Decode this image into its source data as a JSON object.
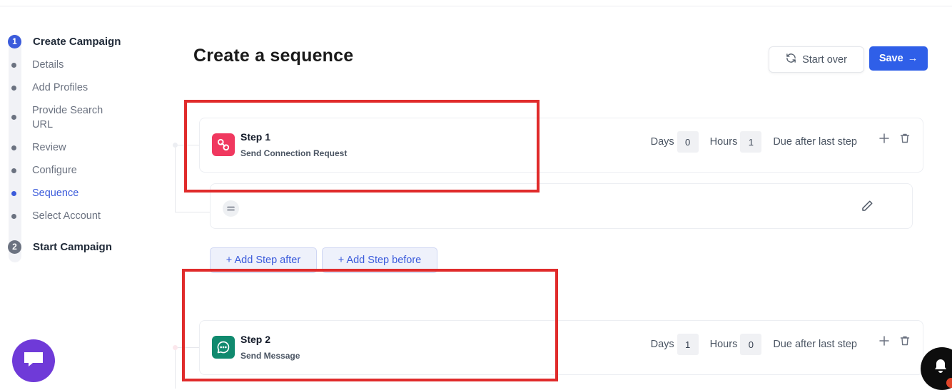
{
  "sidebar": {
    "step1": {
      "number": "1",
      "label": "Create Campaign"
    },
    "items": [
      {
        "label": "Details",
        "active": false
      },
      {
        "label": "Add Profiles",
        "active": false
      },
      {
        "label": "Provide Search URL",
        "active": false
      },
      {
        "label": "Review",
        "active": false
      },
      {
        "label": "Configure",
        "active": false
      },
      {
        "label": "Sequence",
        "active": true
      },
      {
        "label": "Select Account",
        "active": false
      }
    ],
    "step2": {
      "number": "2",
      "label": "Start Campaign"
    }
  },
  "header": {
    "title": "Create a sequence",
    "start_over_label": "Start over",
    "save_label": "Save",
    "save_arrow": "→"
  },
  "steps": [
    {
      "title": "Step 1",
      "subtitle": "Send Connection Request",
      "icon": "link-icon",
      "icon_color": "#f0385f",
      "days_label": "Days",
      "days": "0",
      "hours_label": "Hours",
      "hours": "1",
      "due_label": "Due after last step"
    },
    {
      "title": "Step 2",
      "subtitle": "Send Message",
      "icon": "message-icon",
      "icon_color": "#108a6e",
      "days_label": "Days",
      "days": "1",
      "hours_label": "Hours",
      "hours": "0",
      "due_label": "Due after last step"
    }
  ],
  "actions": {
    "add_after": "+ Add Step after",
    "add_before": "+ Add Step before"
  },
  "colors": {
    "accent": "#3b5bdb",
    "save": "#2f5fe8",
    "highlight": "#e02b2b",
    "chat": "#6f3ad8"
  }
}
